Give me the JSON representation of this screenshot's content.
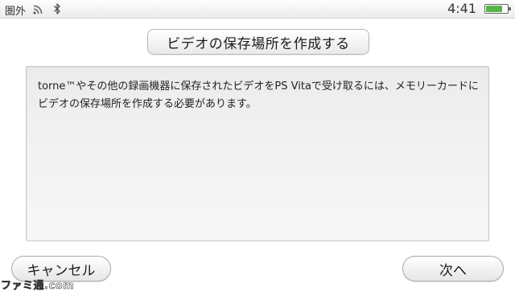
{
  "status_bar": {
    "signal_text": "圏外",
    "wifi_icon": "wifi-icon",
    "bluetooth_icon": "bluetooth-icon",
    "clock": "4:41",
    "battery_icon": "battery-icon",
    "battery_level": 0.8,
    "battery_color": "#5ab34a"
  },
  "dialog": {
    "title": "ビデオの保存場所を作成する",
    "message": "torne™やその他の録画機器に保存されたビデオをPS Vitaで受け取るには、メモリーカードにビデオの保存場所を作成する必要があります。"
  },
  "buttons": {
    "cancel_label": "キャンセル",
    "next_label": "次へ"
  },
  "watermark": {
    "text": "ファミ通.com"
  }
}
